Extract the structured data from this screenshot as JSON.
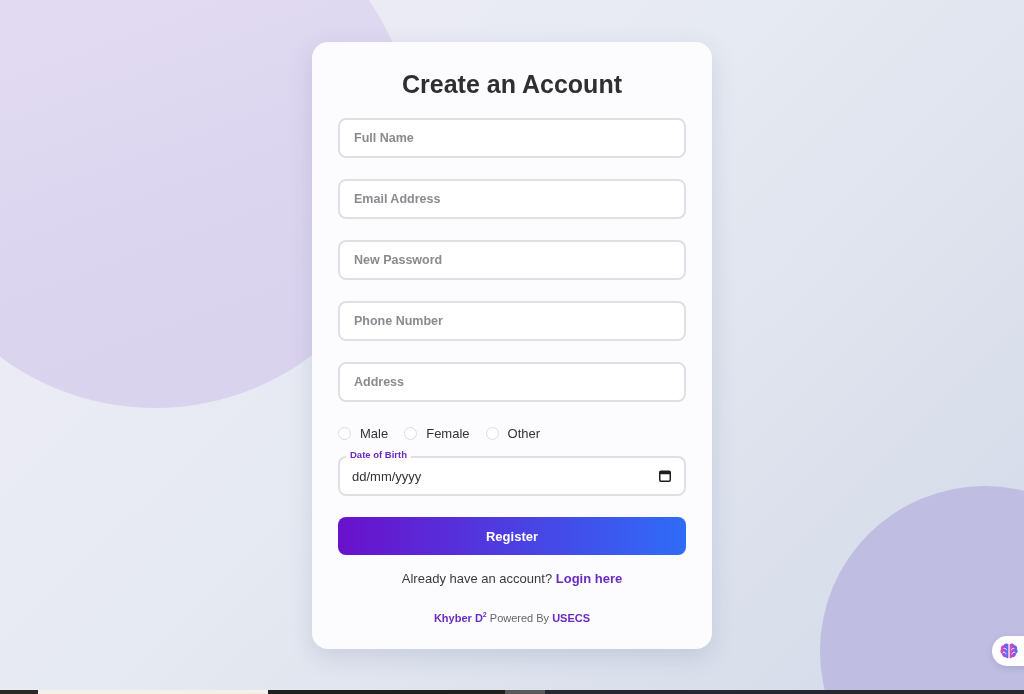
{
  "form": {
    "title": "Create an Account",
    "fields": [
      {
        "placeholder": "Full Name"
      },
      {
        "placeholder": "Email Address"
      },
      {
        "placeholder": "New Password"
      },
      {
        "placeholder": "Phone Number"
      },
      {
        "placeholder": "Address"
      }
    ],
    "gender_options": [
      {
        "label": "Male",
        "selected": false
      },
      {
        "label": "Female",
        "selected": false
      },
      {
        "label": "Other",
        "selected": false
      }
    ],
    "date_field": {
      "label": "Date of Birth",
      "placeholder": "dd/mm/yyyy"
    },
    "submit_button": "Register",
    "login_prompt": {
      "text": "Already have an account?",
      "link": "Login here"
    },
    "footer": "**Khyber D$^{2}$** Powered By **USECS**"
  }
}
